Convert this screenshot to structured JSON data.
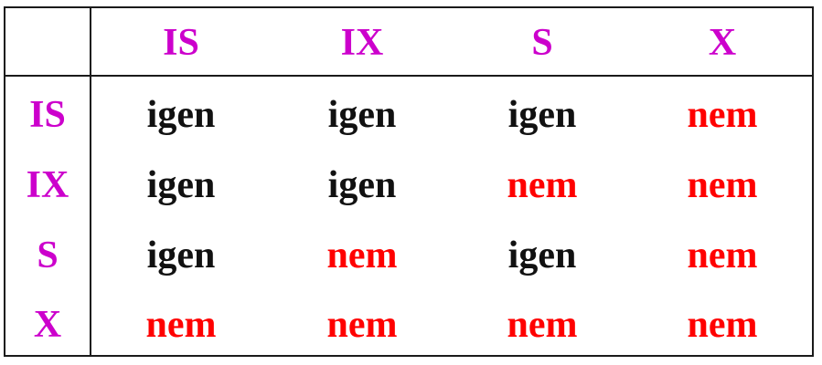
{
  "colors": {
    "header": "#cc00cc",
    "yes": "#111111",
    "no": "#ff0000",
    "border": "#1a1a1a"
  },
  "table": {
    "corner": "",
    "columns": [
      "IS",
      "IX",
      "S",
      "X"
    ],
    "rows": [
      {
        "label": "IS",
        "cells": [
          "igen",
          "igen",
          "igen",
          "nem"
        ]
      },
      {
        "label": "IX",
        "cells": [
          "igen",
          "igen",
          "nem",
          "nem"
        ]
      },
      {
        "label": "S",
        "cells": [
          "igen",
          "nem",
          "igen",
          "nem"
        ]
      },
      {
        "label": "X",
        "cells": [
          "nem",
          "nem",
          "nem",
          "nem"
        ]
      }
    ]
  }
}
